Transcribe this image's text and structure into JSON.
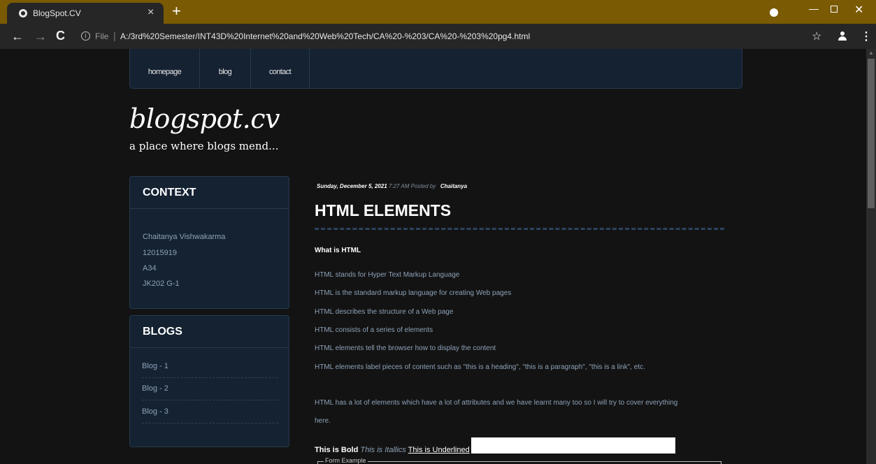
{
  "browser": {
    "tab_title": "BlogSpot.CV",
    "tab_close": "×",
    "new_tab": "+",
    "url_scheme": "File",
    "url": "A:/3rd%20Semester/INT43D%20Internet%20and%20Web%20Tech/CA%20-%203/CA%20-%203%20pg4.html",
    "info_glyph": "i",
    "back_glyph": "←",
    "forward_glyph": "→",
    "reload_glyph": "C",
    "star_glyph": "☆",
    "menu_glyph": "⋮",
    "minimize_glyph": "—",
    "close_glyph": "✕"
  },
  "nav": {
    "items": [
      "homepage",
      "blog",
      "contact"
    ]
  },
  "site": {
    "title": "blogspot.cv",
    "tagline": "a place where blogs mend..."
  },
  "sidebar": {
    "context": {
      "title": "CONTEXT",
      "lines": [
        "Chaitanya Vishwakarma",
        "12015919",
        "A34",
        "JK202 G-1"
      ]
    },
    "blogs": {
      "title": "BLOGS",
      "items": [
        "Blog - 1",
        "Blog - 2",
        "Blog - 3"
      ]
    }
  },
  "post": {
    "date": "Sunday, December 5, 2021",
    "time_posted": "7:27 AM Posted by",
    "author": "Chaitanya",
    "title": "HTML ELEMENTS",
    "subheading": "What is HTML",
    "lines": [
      "HTML stands for Hyper Text Markup Language",
      "HTML is the standard markup language for creating Web pages",
      "HTML describes the structure of a Web page",
      "HTML consists of a series of elements",
      "HTML elements tell the browser how to display the content",
      "HTML elements label pieces of content such as \"this is a heading\", \"this is a paragraph\", \"this is a link\", etc."
    ],
    "para2_line1": "HTML has a lot of elements which have a lot of attributes and we have learnt many too so I will try to cover everything",
    "para2_line2": "here.",
    "bold_text": "This is Bold",
    "italic_text": "This is Itallics",
    "underline_text": "This is Underlined",
    "legend": "Form Example"
  },
  "colors": {
    "tab_strip": "#7a5a02",
    "page_bg": "#131313",
    "panel_bg": "#152232",
    "panel_border": "#263a4e",
    "text_muted": "#8da2b8"
  }
}
